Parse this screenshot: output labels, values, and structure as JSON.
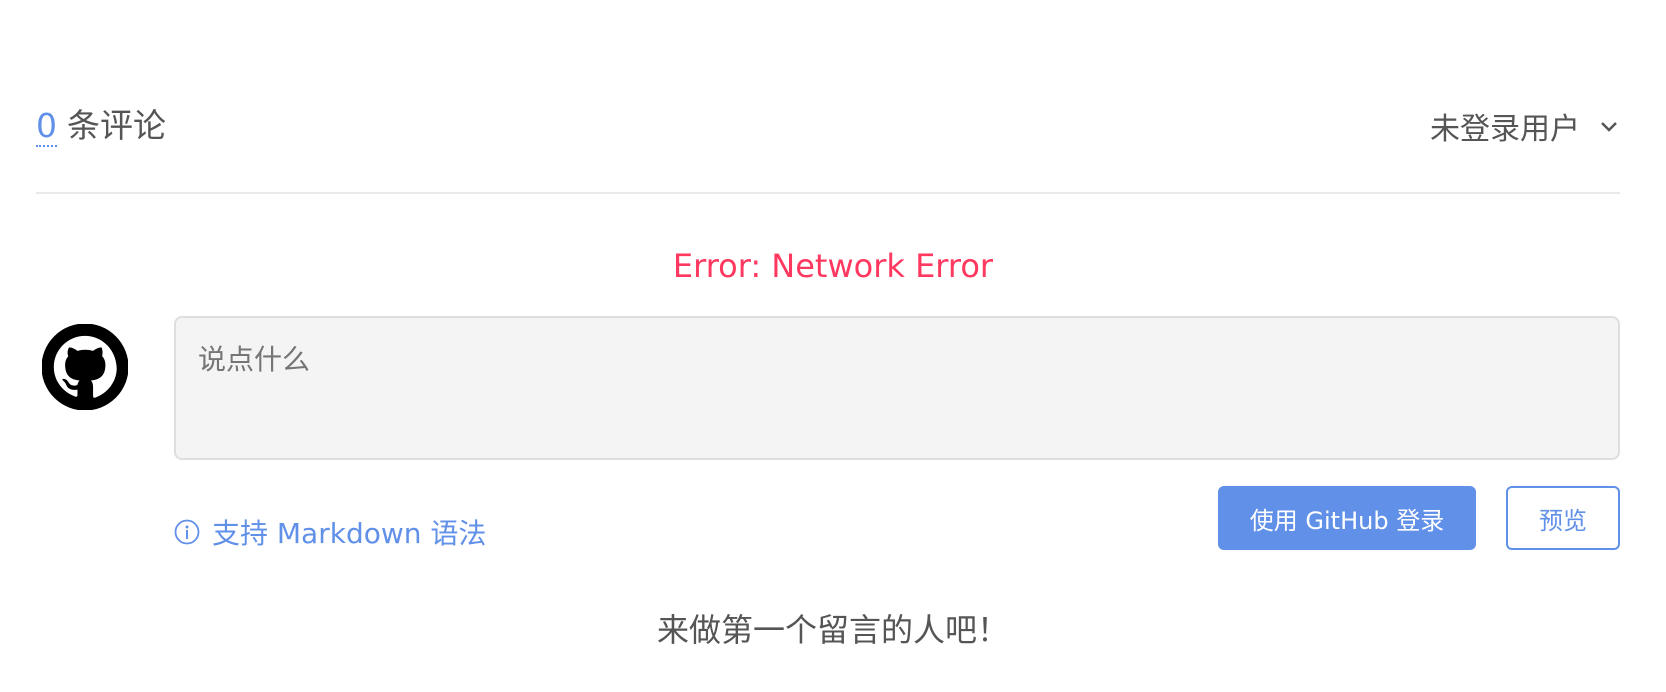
{
  "header": {
    "comment_count": "0",
    "comment_label": "条评论",
    "user_menu_label": "未登录用户"
  },
  "error_message": "Error: Network Error",
  "editor": {
    "placeholder": "说点什么",
    "value": ""
  },
  "markdown_hint": "支持 Markdown 语法",
  "buttons": {
    "login_label": "使用 GitHub 登录",
    "preview_label": "预览"
  },
  "empty_message": "来做第一个留言的人吧！",
  "icons": {
    "avatar": "github-icon",
    "user_menu": "chevron-down-icon",
    "hint": "info-icon"
  },
  "colors": {
    "accent": "#6190e8",
    "error": "#ff3860",
    "text": "#555555"
  }
}
